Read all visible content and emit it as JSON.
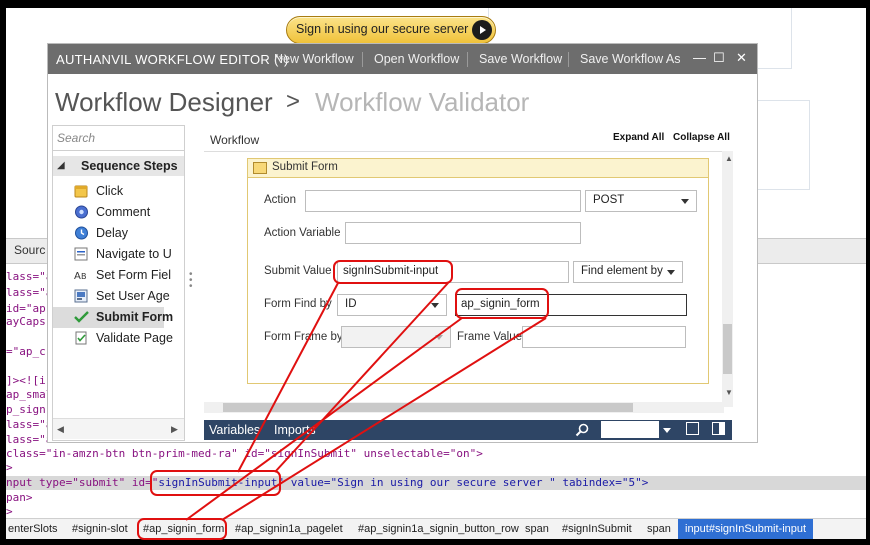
{
  "background_page": {
    "signin_button": "Sign in using our secure server",
    "devtools_tab": "Sourc",
    "code_lines": [
      {
        "kind": "frag",
        "text": "lass=\"a"
      },
      {
        "kind": "frag",
        "text": "lass=\"a"
      },
      {
        "kind": "frag",
        "text": "id=\"ap"
      },
      {
        "kind": "frag",
        "text": "ayCaps"
      },
      {
        "kind": "frag",
        "text": "=\"ap_c"
      },
      {
        "kind": "frag",
        "text": "]><![i"
      },
      {
        "kind": "frag",
        "text": "ap_smal"
      },
      {
        "kind": "frag",
        "text": "p_sign"
      },
      {
        "kind": "frag",
        "text": "lass=\"a"
      },
      {
        "kind": "frag",
        "text": "lass=\"a"
      }
    ],
    "code_line_button": "class=\"in-amzn-btn btn-prim-med-ra\" id=\"signInSubmit\" unselectable=\"on\">",
    "code_line_close1": ">",
    "code_line_input_prefix": "nput type=\"submit\" id=\"",
    "code_line_input_id": "signInSubmit-input",
    "code_line_input_suffix": "\" value=\"Sign in using our secure server \" tabindex=\"5\">",
    "code_line_span_close": "pan>",
    "code_line_close2": ">",
    "breadcrumbs": [
      "enterSlots",
      "#signin-slot",
      "#ap_signin_form",
      "#ap_signin1a_pagelet",
      "#ap_signin1a_signin_button_row",
      "span",
      "#signInSubmit",
      "span",
      "input#signInSubmit-input"
    ]
  },
  "editor": {
    "title": "AUTHANVIL WORKFLOW EDITOR (*)",
    "menu": [
      "New Workflow",
      "Open Workflow",
      "Save Workflow",
      "Save Workflow As"
    ],
    "window_controls": {
      "minimize": "—",
      "maximize": "☐",
      "close": "✕"
    },
    "breadcrumb_main": "Workflow Designer",
    "breadcrumb_sep": ">",
    "breadcrumb_sub": "Workflow Validator",
    "steps": {
      "search_placeholder": "Search",
      "group": "Sequence Steps",
      "items": [
        {
          "label": "Click",
          "icon": "click-icon"
        },
        {
          "label": "Comment",
          "icon": "comment-icon"
        },
        {
          "label": "Delay",
          "icon": "clock-icon"
        },
        {
          "label": "Navigate to U",
          "icon": "navigate-icon"
        },
        {
          "label": "Set Form Fiel",
          "icon": "form-field-icon"
        },
        {
          "label": "Set User Age",
          "icon": "user-agent-icon"
        },
        {
          "label": "Submit Form",
          "icon": "checkmark-icon"
        },
        {
          "label": "Validate Page",
          "icon": "validate-icon"
        }
      ],
      "selected_index": 6
    },
    "workflow": {
      "label": "Workflow",
      "expand_all": "Expand All",
      "collapse_all": "Collapse All",
      "step_title": "Submit Form",
      "fields": {
        "action_label": "Action",
        "action_value": "",
        "method": "POST",
        "action_variable_label": "Action Variable",
        "action_variable_value": "",
        "submit_value_label": "Submit Value",
        "submit_value": "signInSubmit-input",
        "find_element_by": "Find element by",
        "form_find_by_label": "Form Find by",
        "form_find_by": "ID",
        "form_find_value": "ap_signin_form",
        "form_frame_by_label": "Form Frame by",
        "form_frame_by": "",
        "frame_value_label": "Frame Value",
        "frame_value": ""
      }
    },
    "bottom_tabs": [
      "Variables",
      "Imports"
    ]
  },
  "colors": {
    "title_bar": "#6d6d6d",
    "bottom_bar": "#2e4565",
    "annotation": "#e01010",
    "selection": "#2f6fd3"
  }
}
